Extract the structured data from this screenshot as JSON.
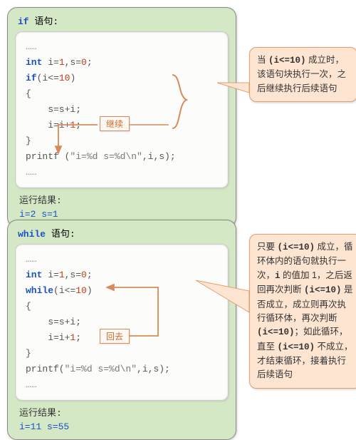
{
  "panel1": {
    "title_kw": "if",
    "title_suffix": " 语句:",
    "code": {
      "dots1": "……",
      "l1_a": "int",
      "l1_b": " i=",
      "l1_c": "1",
      "l1_d": ",s=",
      "l1_e": "0",
      "l1_f": ";",
      "l2_a": "if",
      "l2_b": "(i<=",
      "l2_c": "10",
      "l2_d": ")",
      "l3": "{",
      "l4_a": "    s=s+i;",
      "l5_a": "    i=i+",
      "l5_b": "1",
      "l5_c": ";",
      "l6": "}",
      "l7_a": "printf (",
      "l7_b": "\"i=%d s=%d\\n\"",
      "l7_c": ",i,s);",
      "dots2": "……"
    },
    "tag": "继续",
    "result_label": "运行结果:",
    "result_val": "i=2 s=1",
    "callout_parts": {
      "p1": "当 ",
      "cond": "(i<=10)",
      "p2": " 成立时，该语句块执行一次，之后继续执行后续语句"
    }
  },
  "panel2": {
    "title_kw": "while",
    "title_suffix": " 语句:",
    "code": {
      "dots1": "……",
      "l1_a": "int",
      "l1_b": " i=",
      "l1_c": "1",
      "l1_d": ",s=",
      "l1_e": "0",
      "l1_f": ";",
      "l2_a": "while",
      "l2_b": "(i<=",
      "l2_c": "10",
      "l2_d": ")",
      "l3": "{",
      "l4_a": "    s=s+i;",
      "l5_a": "    i=i+",
      "l5_b": "1",
      "l5_c": ";",
      "l6": "}",
      "l7_a": "printf(",
      "l7_b": "\"i=%d s=%d\\n\"",
      "l7_c": ",i,s);",
      "dots2": "……"
    },
    "tag": "回去",
    "result_label": "运行结果:",
    "result_val": "i=11 s=55",
    "callout_parts": {
      "p1": "只要 ",
      "c1": "(i<=10)",
      "p2": " 成立，循环体内的语句就执行一次，",
      "c2": "i",
      "p3": " 的值加 1，之后返回再次判断 ",
      "c3": "(i<=10)",
      "p4": " 是否成立，成立则再次执行循环体，再次判断 ",
      "c4": "(i<=10)",
      "p5": "；如此循环，直至 ",
      "c5": "(i<=10)",
      "p6": " 不成立，才结束循环，接着执行后续语句"
    }
  }
}
